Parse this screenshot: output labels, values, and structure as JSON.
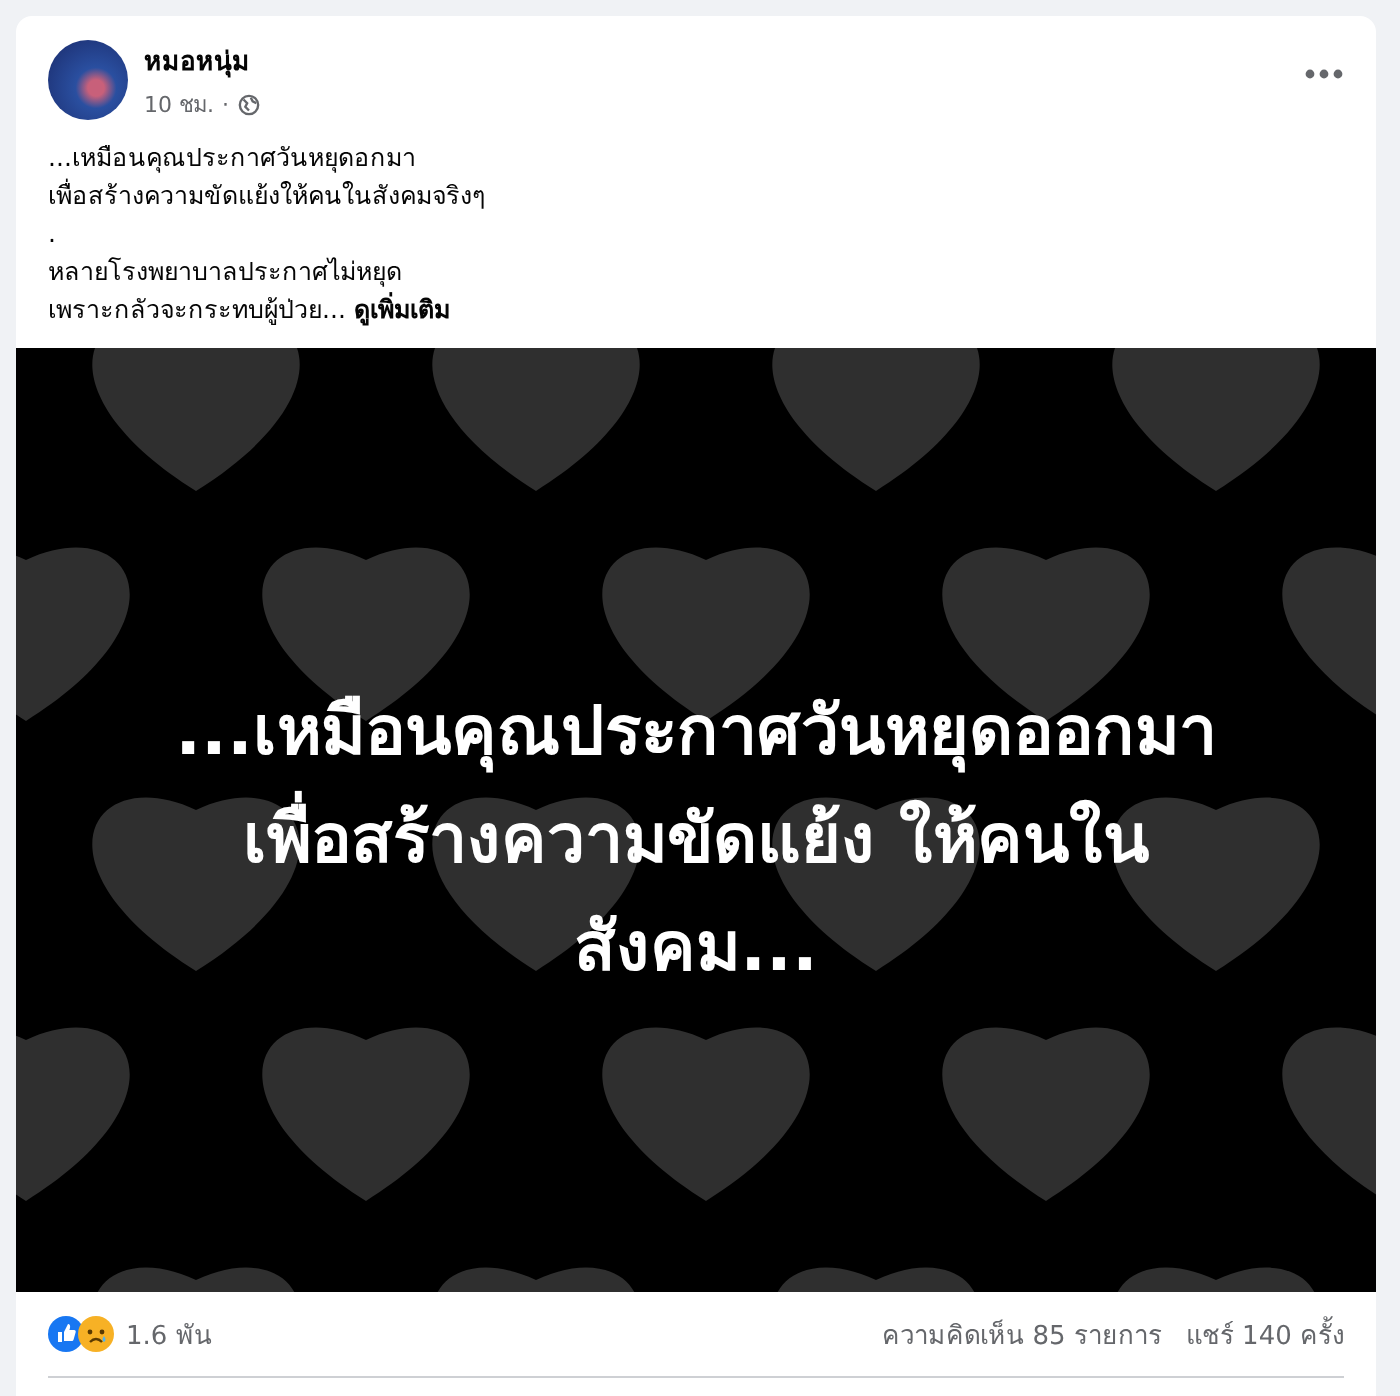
{
  "post": {
    "author": "หมอหนุ่ม",
    "time": "10 ชม.",
    "separator": "·",
    "body_lines": [
      "...เหมือนคุณประกาศวันหยุดอกมา",
      "เพื่อสร้างความขัดแย้งให้คนในสังคมจริงๆ",
      ".",
      "หลายโรงพยาบาลประกาศไม่หยุด",
      "เพราะกลัวจะกระทบผู้ป่วย..."
    ],
    "see_more": "ดูเพิ่มเติม",
    "image_text": [
      "...เหมือนคุณประกาศวันหยุดออกมา",
      "เพื่อสร้างความขัดแย้ง ให้คนใน",
      "สังคม..."
    ],
    "reaction_count": "1.6 พัน",
    "comments": "ความคิดเห็น 85 รายการ",
    "shares": "แชร์ 140 ครั้ง"
  }
}
